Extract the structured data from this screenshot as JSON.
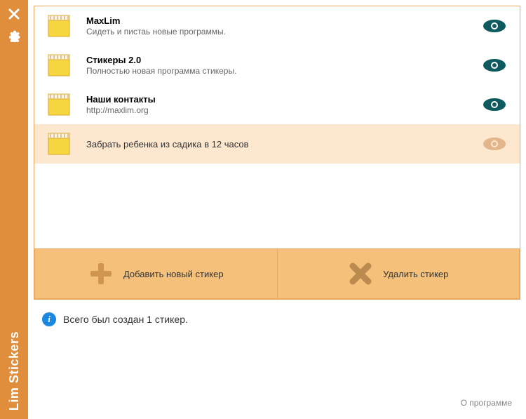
{
  "app": {
    "title": "Lim Stickers",
    "about_label": "О программе",
    "status_text": "Всего был создан 1 стикер."
  },
  "actions": {
    "add": "Добавить новый стикер",
    "delete": "Удалить стикер"
  },
  "stickers": [
    {
      "title": "MaxLim",
      "subtitle": "Сидеть и пистаь новые программы.",
      "selected": false,
      "visible": true
    },
    {
      "title": "Стикеры 2.0",
      "subtitle": "Полностью новая программа стикеры.",
      "selected": false,
      "visible": true
    },
    {
      "title": "Наши контакты",
      "subtitle": "http://maxlim.org",
      "selected": false,
      "visible": true
    },
    {
      "title": "Забрать ребенка из садика в 12 часов",
      "subtitle": "",
      "selected": true,
      "visible": false
    }
  ],
  "colors": {
    "accent": "#e08d3c",
    "panel_border": "#e8a85e",
    "button_bg": "#f5c17a",
    "selected_bg": "#fde7cf",
    "eye_active": "#0e5a5f",
    "eye_inactive": "#e2b58a",
    "note_bg": "#f7d741",
    "plus_color": "#d09650",
    "x_color": "#bb8a4e"
  }
}
